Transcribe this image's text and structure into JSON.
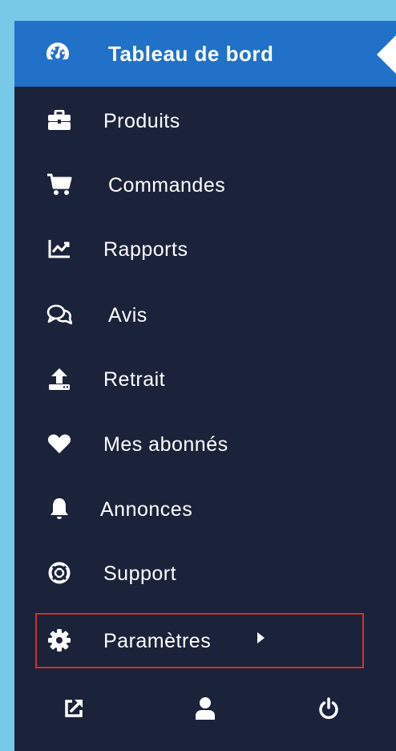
{
  "menu": {
    "items": [
      {
        "label": "Tableau de bord",
        "icon": "dashboard-gauge-icon",
        "active": true
      },
      {
        "label": "Produits",
        "icon": "briefcase-icon"
      },
      {
        "label": "Commandes",
        "icon": "shopping-cart-icon"
      },
      {
        "label": "Rapports",
        "icon": "line-chart-icon"
      },
      {
        "label": "Avis",
        "icon": "comments-icon"
      },
      {
        "label": "Retrait",
        "icon": "upload-icon"
      },
      {
        "label": "Mes abonnés",
        "icon": "heart-icon"
      },
      {
        "label": "Annonces",
        "icon": "bell-icon"
      },
      {
        "label": "Support",
        "icon": "life-ring-icon"
      },
      {
        "label": "Paramètres",
        "icon": "gear-icon",
        "has_submenu": true
      }
    ]
  },
  "bottom_bar": {
    "icons": [
      "external-link-icon",
      "user-icon",
      "power-icon"
    ]
  },
  "colors": {
    "background": "#78c8e8",
    "panel": "#1b233a",
    "active": "#2271c8",
    "highlight_border": "#d0312d",
    "text": "#ffffff"
  }
}
